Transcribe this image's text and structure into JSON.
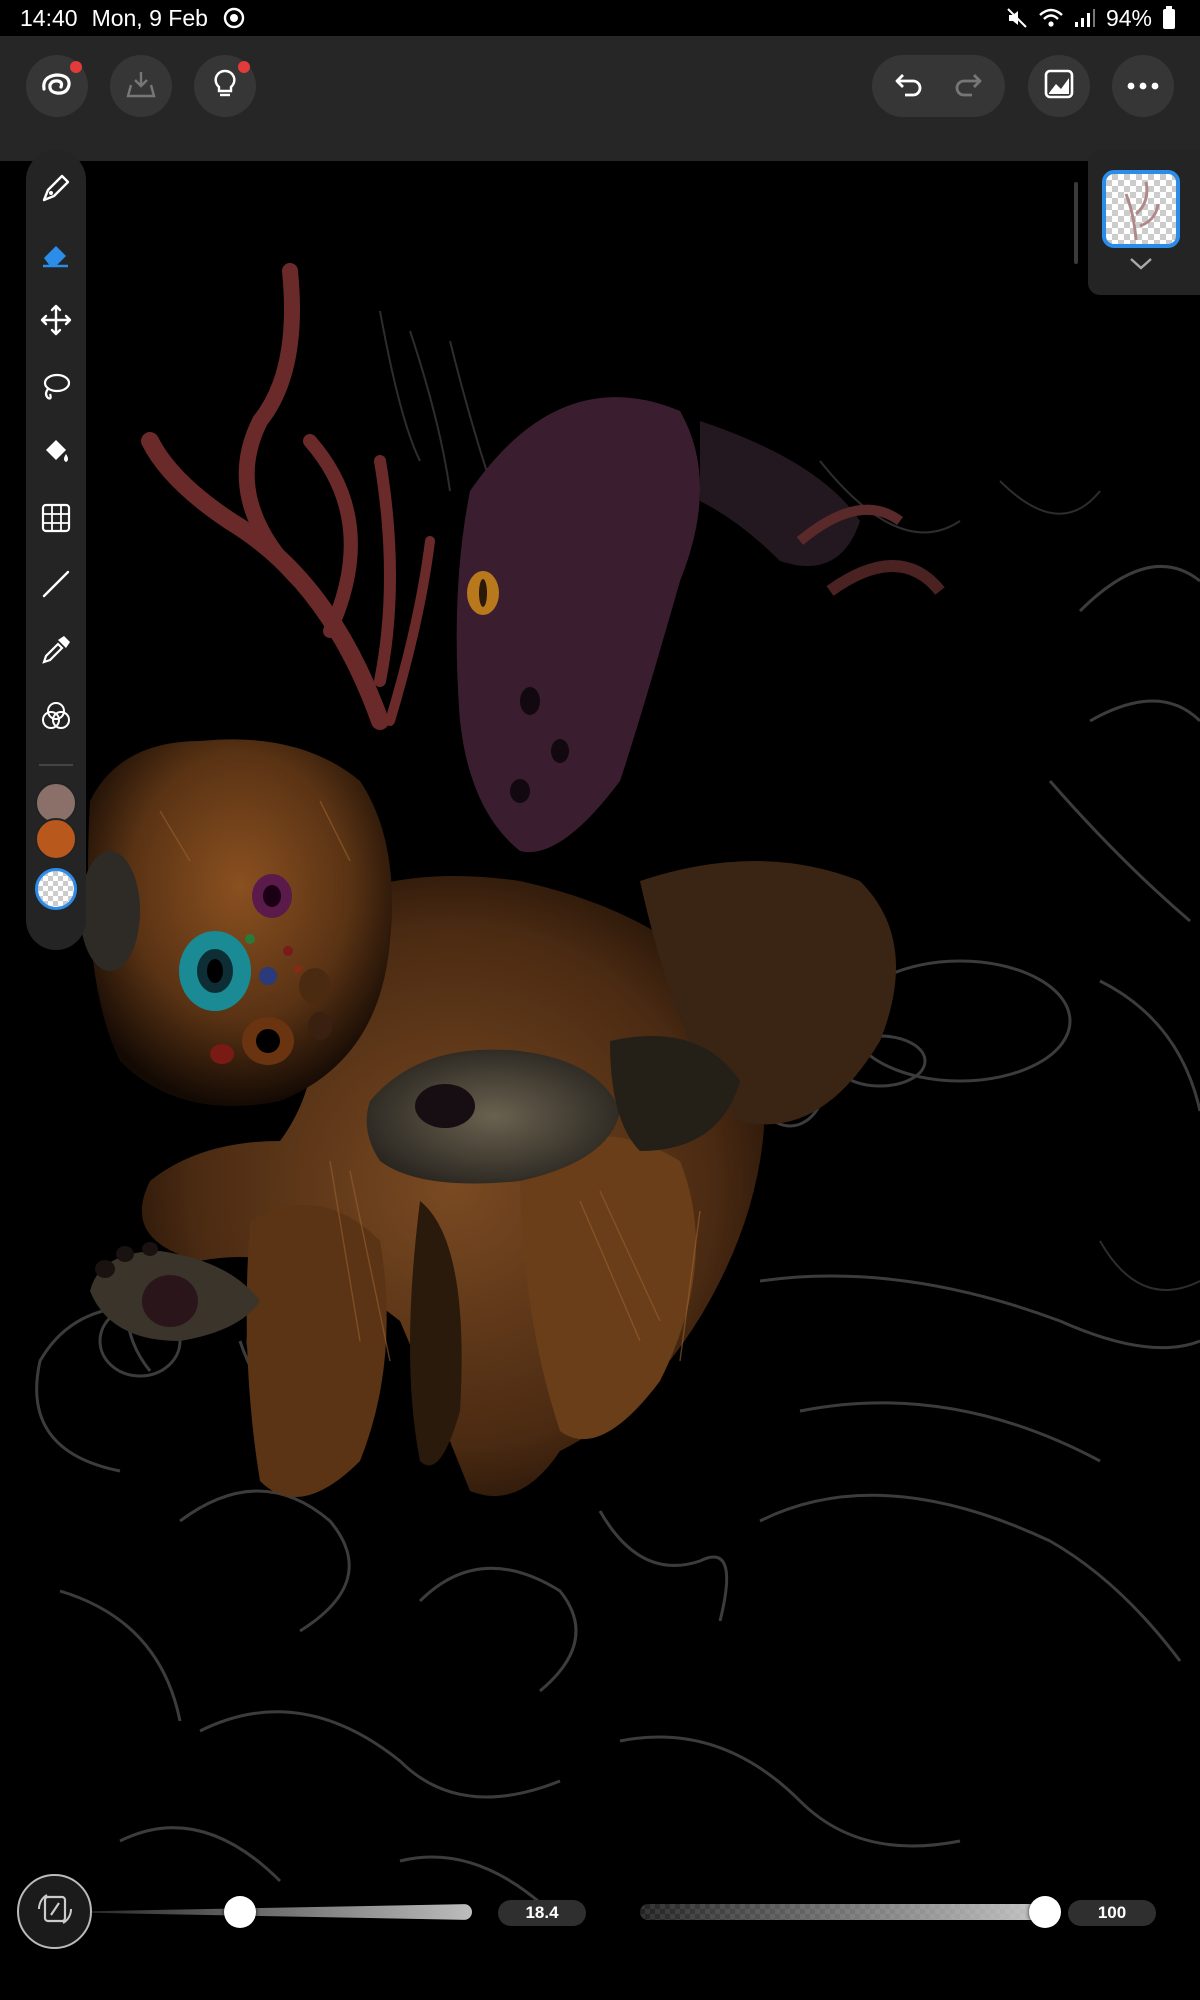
{
  "status_bar": {
    "time": "14:40",
    "date": "Mon, 9 Feb",
    "battery": "94%"
  },
  "toolbar": {
    "left_icons": [
      "app-logo-icon",
      "import-icon",
      "tips-icon"
    ],
    "right_icons": [
      "undo-icon",
      "redo-icon",
      "gallery-icon",
      "more-icon"
    ],
    "accent_color": "#2b8de8",
    "notification_color": "#e23b3b"
  },
  "tools": [
    {
      "name": "brush-tool",
      "icon": "pen-icon",
      "active": false
    },
    {
      "name": "eraser-tool",
      "icon": "eraser-icon",
      "active": true
    },
    {
      "name": "transform-tool",
      "icon": "move-arrows-icon",
      "active": false
    },
    {
      "name": "lasso-tool",
      "icon": "lasso-icon",
      "active": false
    },
    {
      "name": "fill-tool",
      "icon": "paint-bucket-icon",
      "active": false
    },
    {
      "name": "perspective-grid-tool",
      "icon": "grid-icon",
      "active": false
    },
    {
      "name": "line-tool",
      "icon": "line-icon",
      "active": false
    },
    {
      "name": "eyedropper-tool",
      "icon": "eyedropper-icon",
      "active": false
    },
    {
      "name": "color-blend-tool",
      "icon": "color-circles-icon",
      "active": false
    }
  ],
  "swatches": [
    "#8a7068",
    "#b8581c",
    "transparent"
  ],
  "layers": {
    "selected_layer_icon": "layer-thumbnail",
    "expand_icon": "chevron-down-icon"
  },
  "brush_size": {
    "value": "18.4",
    "fraction": 0.39
  },
  "brush_opacity": {
    "value": "100",
    "fraction": 1.0
  }
}
